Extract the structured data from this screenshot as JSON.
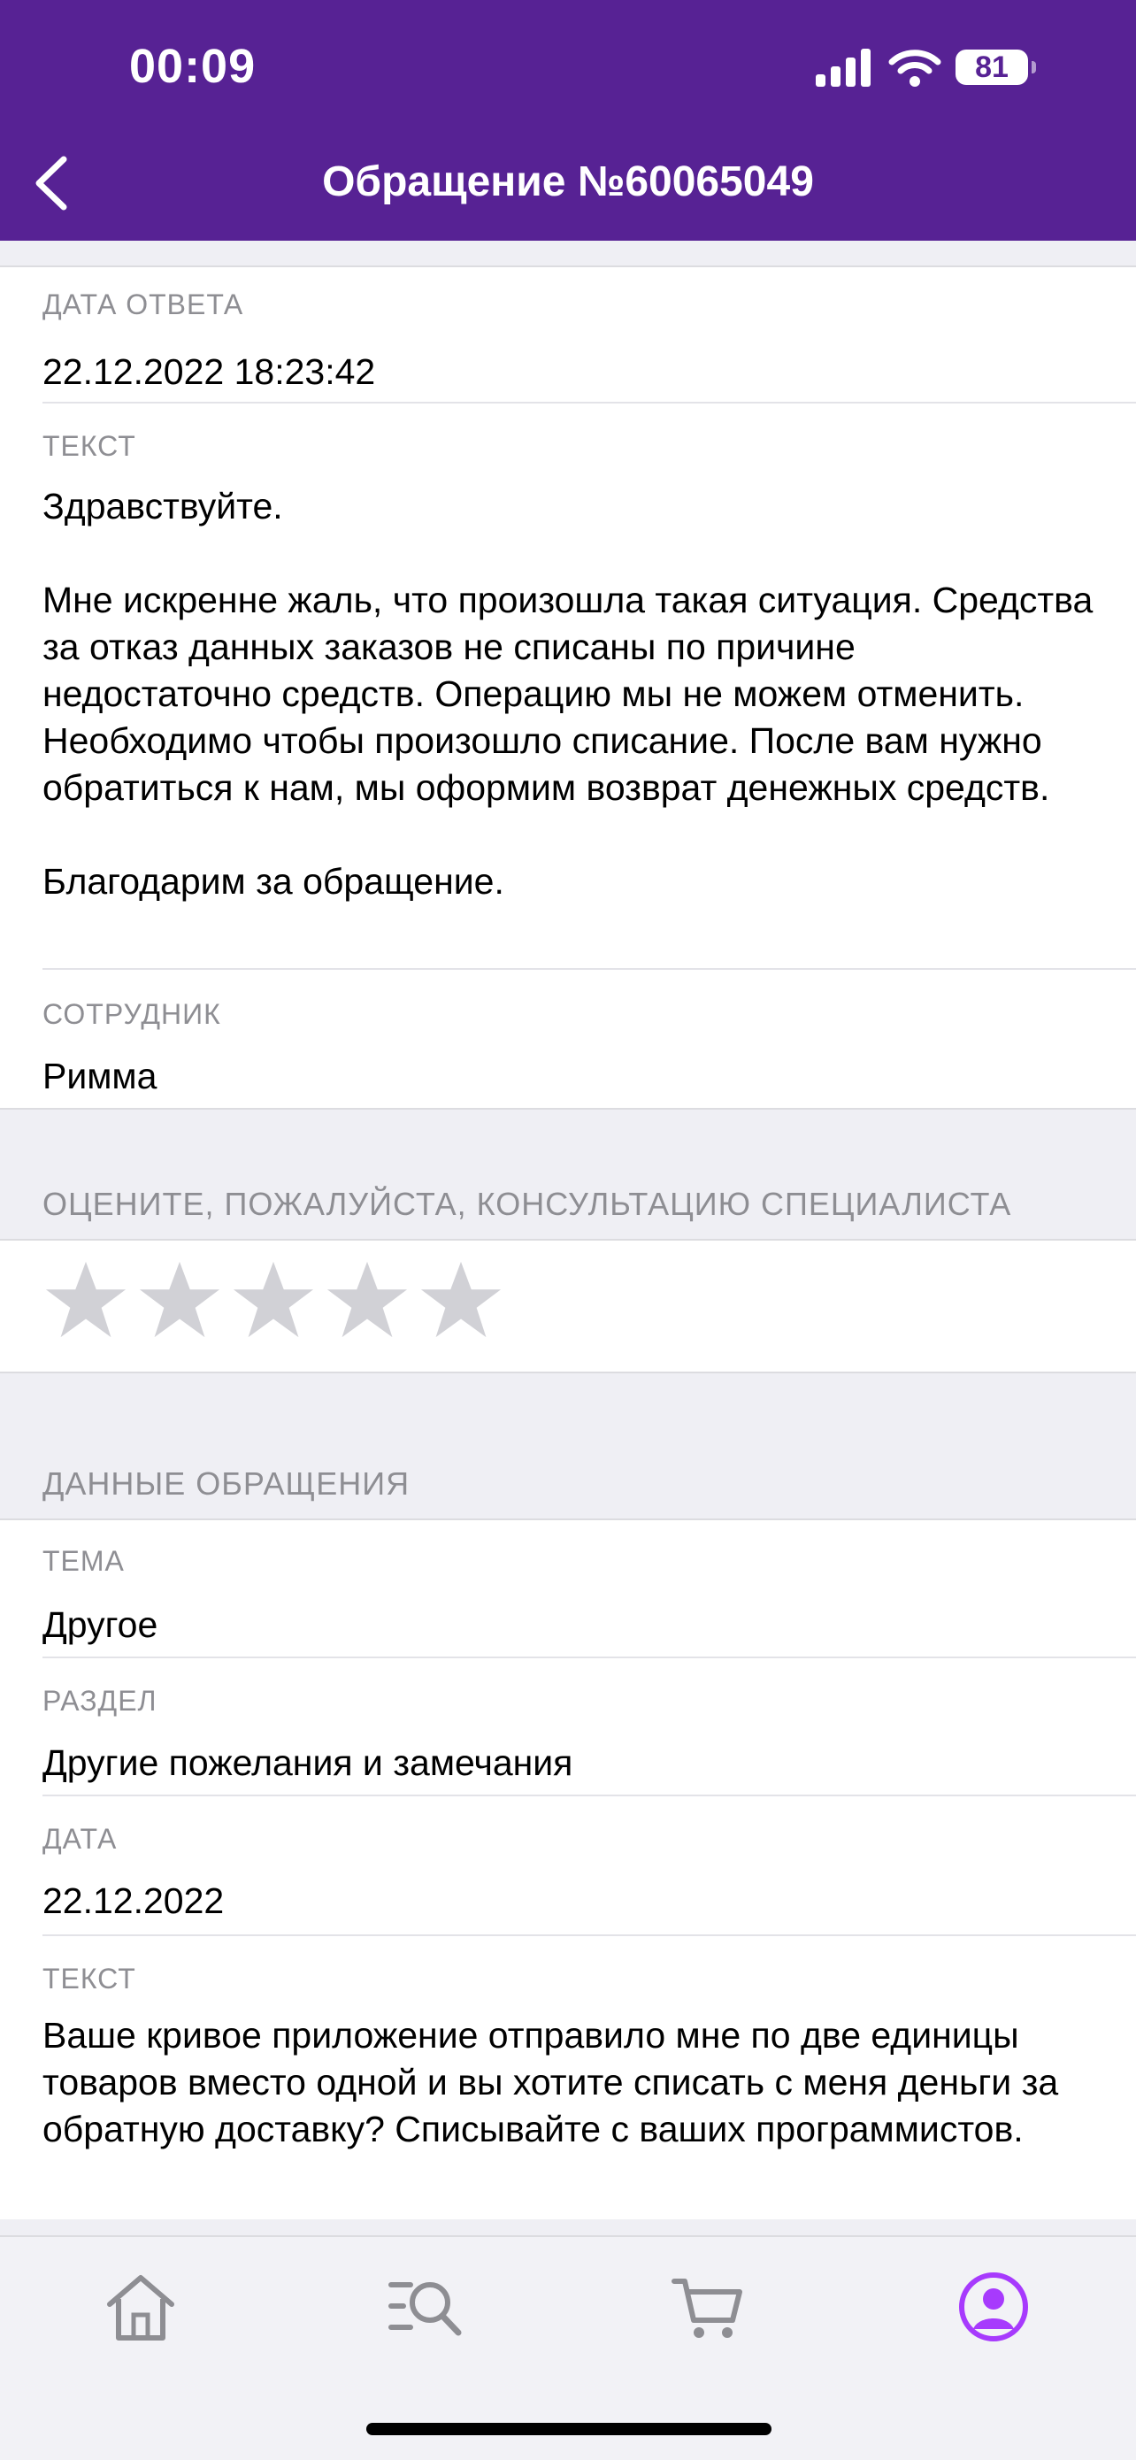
{
  "status_bar": {
    "time": "00:09",
    "battery": "81"
  },
  "nav": {
    "title": "Обращение №60065049"
  },
  "answer": {
    "date_label": "ДАТА ОТВЕТА",
    "date_value": "22.12.2022 18:23:42",
    "text_label": "ТЕКСТ",
    "text_value": "Здравствуйте.\n\nМне искренне жаль, что произошла такая ситуация. Средства за отказ данных заказов не списаны по причине недостаточно средств. Операцию мы не можем отменить. Необходимо чтобы произошло списание. После вам нужно обратиться к нам, мы оформим возврат денежных средств.\n\nБлагодарим за обращение.",
    "employee_label": "СОТРУДНИК",
    "employee_value": "Римма"
  },
  "rating": {
    "title": "ОЦЕНИТЕ, ПОЖАЛУЙСТА, КОНСУЛЬТАЦИЮ СПЕЦИАЛИСТА",
    "value": 0,
    "max": 5
  },
  "request": {
    "section_title": "ДАННЫЕ ОБРАЩЕНИЯ",
    "topic_label": "ТЕМА",
    "topic_value": "Другое",
    "section_label": "РАЗДЕЛ",
    "section_value": "Другие пожелания и замечания",
    "date_label": "ДАТА",
    "date_value": "22.12.2022",
    "text_label": "ТЕКСТ",
    "text_value": "Ваше кривое приложение отправило мне по две единицы товаров вместо одной и вы хотите списать с меня деньги за обратную доставку? Списывайте с ваших программистов."
  },
  "tabbar": {
    "items": [
      {
        "icon": "home-icon",
        "active": false
      },
      {
        "icon": "search-list-icon",
        "active": false
      },
      {
        "icon": "cart-icon",
        "active": false
      },
      {
        "icon": "profile-icon",
        "active": true
      }
    ]
  },
  "colors": {
    "brand": "#572294",
    "active_tab": "#a73afd",
    "inactive_tab": "#8e8e93",
    "star_empty": "#d1d1d6"
  }
}
